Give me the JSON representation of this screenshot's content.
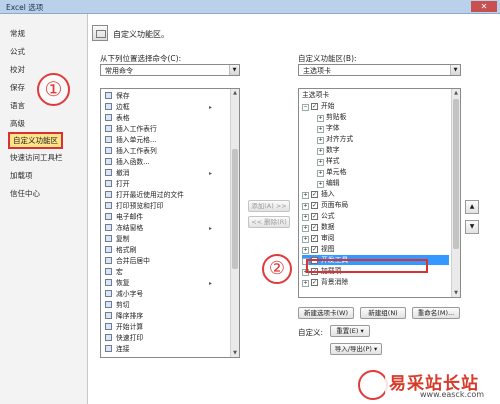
{
  "window": {
    "title": "Excel 选项",
    "close": "✕"
  },
  "sidebar": {
    "items": [
      "常规",
      "公式",
      "校对",
      "保存",
      "语言",
      "高级",
      "自定义功能区",
      "快速访问工具栏",
      "加载项",
      "信任中心"
    ],
    "active_index": 6
  },
  "annotations": {
    "step1": "①",
    "step2": "②"
  },
  "header": {
    "title": "自定义功能区。"
  },
  "left": {
    "label": "从下列位置选择命令(C):",
    "dropdown_value": "常用命令",
    "commands": [
      {
        "label": "保存"
      },
      {
        "label": "边框",
        "sub": "▸"
      },
      {
        "label": "表格"
      },
      {
        "label": "插入工作表行"
      },
      {
        "label": "插入单元格..."
      },
      {
        "label": "插入工作表列"
      },
      {
        "label": "插入函数..."
      },
      {
        "label": "撤消",
        "sub": "▸"
      },
      {
        "label": "打开"
      },
      {
        "label": "打开最近使用过的文件"
      },
      {
        "label": "打印预览和打印"
      },
      {
        "label": "电子邮件"
      },
      {
        "label": "冻结窗格",
        "sub": "▸"
      },
      {
        "label": "复制"
      },
      {
        "label": "格式刷"
      },
      {
        "label": "合并后居中"
      },
      {
        "label": "宏"
      },
      {
        "label": "恢复",
        "sub": "▸"
      },
      {
        "label": "减小字号"
      },
      {
        "label": "剪切"
      },
      {
        "label": "降序排序"
      },
      {
        "label": "开始计算"
      },
      {
        "label": "快速打印"
      },
      {
        "label": "连接"
      }
    ]
  },
  "middle": {
    "add": "添加(A) >>",
    "remove": "<< 删除(R)"
  },
  "right": {
    "label": "自定义功能区(B):",
    "dropdown_value": "主选项卡",
    "tree_header": "主选项卡",
    "tree": [
      {
        "label": "开始",
        "level": 0,
        "exp": "⊟",
        "checked": true
      },
      {
        "label": "剪贴板",
        "level": 1,
        "exp": "⊞"
      },
      {
        "label": "字体",
        "level": 1,
        "exp": "⊞"
      },
      {
        "label": "对齐方式",
        "level": 1,
        "exp": "⊞"
      },
      {
        "label": "数字",
        "level": 1,
        "exp": "⊞"
      },
      {
        "label": "样式",
        "level": 1,
        "exp": "⊞"
      },
      {
        "label": "单元格",
        "level": 1,
        "exp": "⊞"
      },
      {
        "label": "编辑",
        "level": 1,
        "exp": "⊞"
      },
      {
        "label": "插入",
        "level": 0,
        "exp": "⊞",
        "checked": true
      },
      {
        "label": "页面布局",
        "level": 0,
        "exp": "⊞",
        "checked": true
      },
      {
        "label": "公式",
        "level": 0,
        "exp": "⊞",
        "checked": true
      },
      {
        "label": "数据",
        "level": 0,
        "exp": "⊞",
        "checked": true
      },
      {
        "label": "审阅",
        "level": 0,
        "exp": "⊞",
        "checked": true
      },
      {
        "label": "视图",
        "level": 0,
        "exp": "⊞",
        "checked": true
      },
      {
        "label": "开发工具",
        "level": 0,
        "exp": "⊞",
        "checked": true,
        "selected": true
      },
      {
        "label": "加载项",
        "level": 0,
        "exp": "⊞",
        "checked": true
      },
      {
        "label": "背景消除",
        "level": 0,
        "exp": "⊞",
        "checked": true
      }
    ],
    "new_tab": "新建选项卡(W)",
    "new_group": "新建组(N)",
    "rename": "重命名(M)...",
    "customize_label": "自定义:",
    "reset": "重置(E) ▾",
    "import_export": "导入/导出(P) ▾",
    "move_up": "▲",
    "move_down": "▼"
  },
  "watermark": {
    "text": "易采站长站",
    "url": "www.easck.com"
  },
  "colors": {
    "accent": "#3399ff",
    "highlight": "#d93232",
    "active_bg": "#ffe48a"
  }
}
